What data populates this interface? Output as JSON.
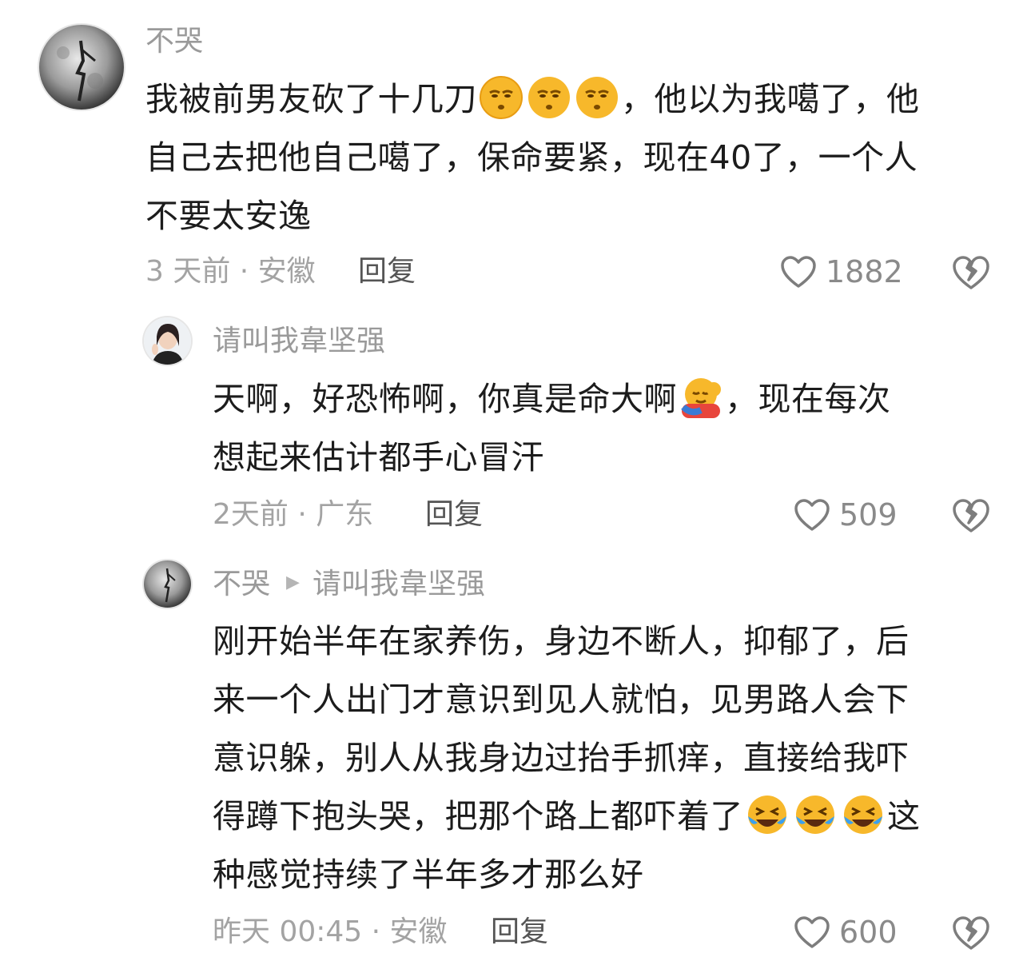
{
  "comments": [
    {
      "user": "不哭",
      "body_line1_a": "我被前男友砍了十几刀",
      "body_line1_b": "，他以为我噶了，他",
      "body_line2": "自己去把他自己噶了，保命要紧，现在40了，一个人",
      "body_line3": "不要太安逸",
      "meta": "3 天前 · 安徽",
      "reply": "回复",
      "likes": "1882",
      "emoji": "face-with-rolling-eyes-emoji"
    },
    {
      "user": "请叫我韋坚强",
      "body_line1_a": "天啊，好恐怖啊，你真是命大啊",
      "body_line1_b": "，现在每次",
      "body_line2": "想起来估计都手心冒汗",
      "meta": "2天前 · 广东",
      "reply": "回复",
      "likes": "509",
      "emoji": "hugging-face-emoji"
    },
    {
      "user": "不哭",
      "reply_to": "请叫我韋坚强",
      "body_line1": "刚开始半年在家养伤，身边不断人，抑郁了，后",
      "body_line2": "来一个人出门才意识到见人就怕，见男路人会下",
      "body_line3": "意识躲，别人从我身边过抬手抓痒，直接给我吓",
      "body_line4_a": "得蹲下抱头哭，把那个路上都吓着了",
      "body_line4_b": "这",
      "body_line5": "种感觉持续了半年多才那么好",
      "meta": "昨天 00:45 · 安徽",
      "reply": "回复",
      "likes": "600",
      "emoji": "crying-laughing-emoji"
    }
  ],
  "colors": {
    "meta_gray": "#a3a3a3",
    "name_gray": "#9a9a9a",
    "text": "#1c1c1c"
  }
}
